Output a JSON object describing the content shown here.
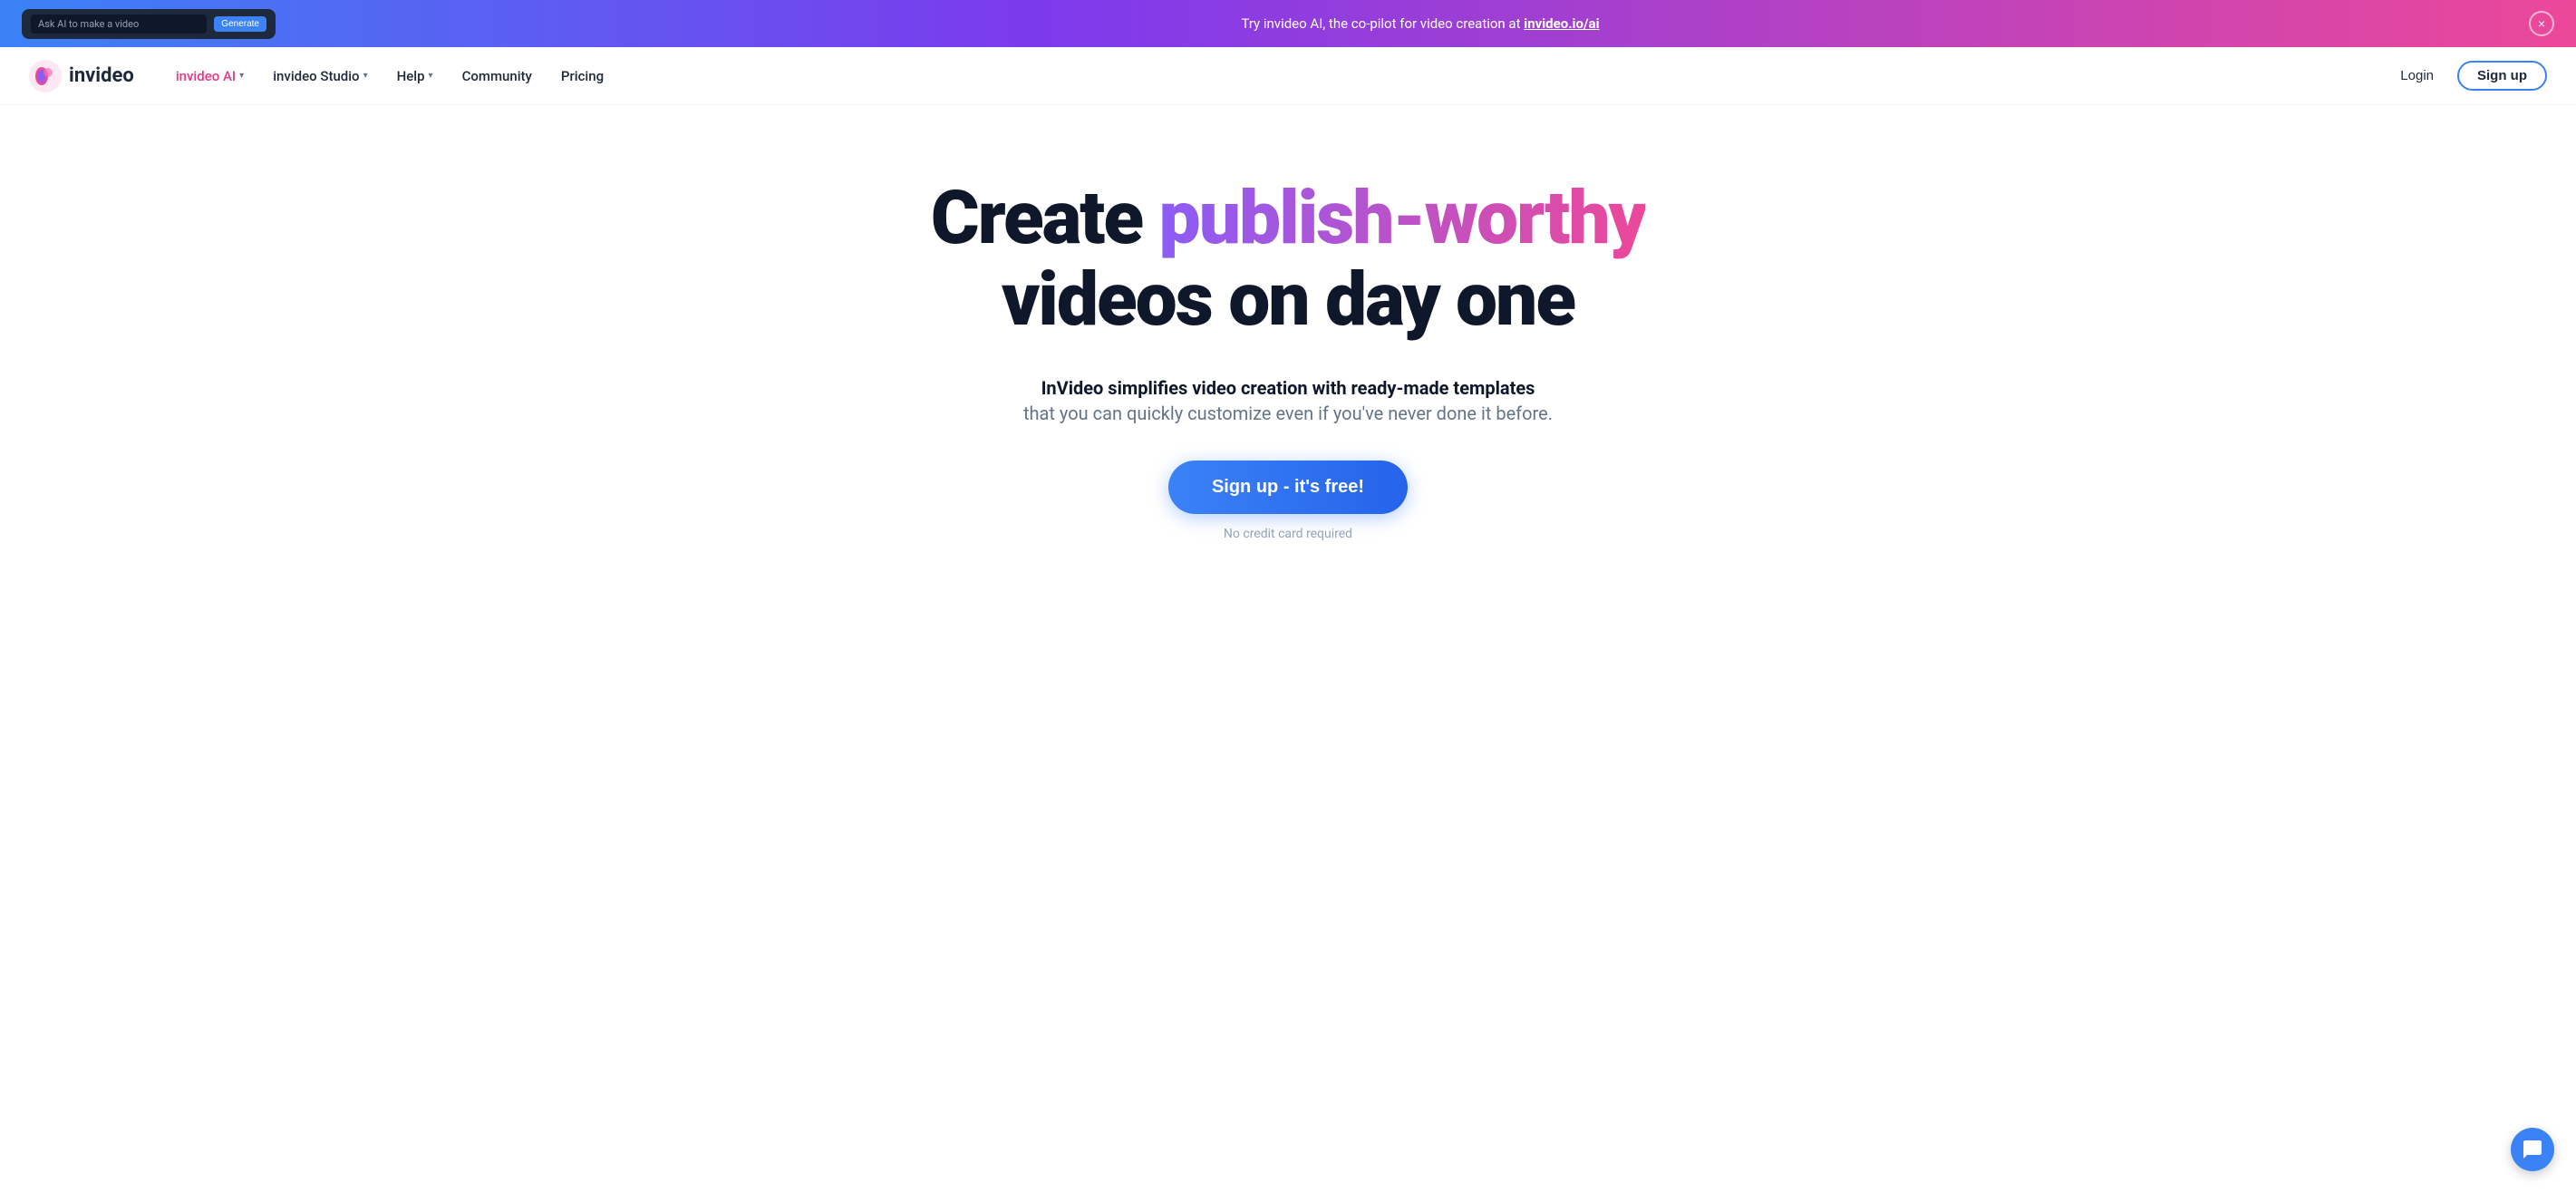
{
  "banner": {
    "preview_input": "Ask AI to make a video",
    "preview_button": "Generate",
    "text_before_link": "Try invideo AI, the co-pilot for video creation at ",
    "link_text": "invideo.io/ai",
    "link_href": "https://invideo.io/ai",
    "close_label": "×"
  },
  "navbar": {
    "logo_text": "invideo",
    "nav_items": [
      {
        "label": "invideo AI",
        "has_dropdown": true,
        "active": true
      },
      {
        "label": "invideo Studio",
        "has_dropdown": true,
        "active": false
      },
      {
        "label": "Help",
        "has_dropdown": true,
        "active": false
      },
      {
        "label": "Community",
        "has_dropdown": false,
        "active": false
      },
      {
        "label": "Pricing",
        "has_dropdown": false,
        "active": false
      }
    ],
    "login_label": "Login",
    "signup_label": "Sign up"
  },
  "hero": {
    "title_part1": "Create ",
    "title_gradient": "publish-worthy",
    "title_part2": "videos on day one",
    "subtitle_bold": "InVideo simplifies video creation with ready-made templates",
    "subtitle_light": "that you can quickly customize even if you've never done it before.",
    "cta_label": "Sign up - it's free!",
    "no_cc_text": "No credit card required"
  }
}
